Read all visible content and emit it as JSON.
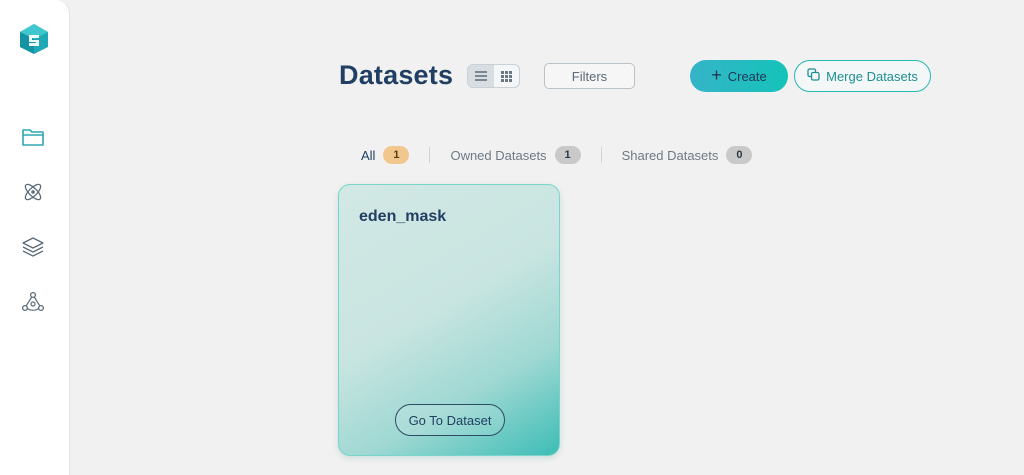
{
  "sidebar": {
    "logo": "app-logo",
    "items": [
      {
        "icon": "folder-icon"
      },
      {
        "icon": "atom-icon"
      },
      {
        "icon": "layers-icon"
      },
      {
        "icon": "network-icon"
      }
    ]
  },
  "header": {
    "title": "Datasets",
    "view_toggle": {
      "options": [
        "list-view-icon",
        "grid-view-icon"
      ],
      "active": "list-view-icon"
    },
    "filters_label": "Filters",
    "create_label": "Create",
    "merge_label": "Merge Datasets"
  },
  "tabs": [
    {
      "label": "All",
      "count": "1",
      "active": true
    },
    {
      "label": "Owned Datasets",
      "count": "1",
      "active": false
    },
    {
      "label": "Shared Datasets",
      "count": "0",
      "active": false
    }
  ],
  "datasets": [
    {
      "name": "eden_mask",
      "action_label": "Go To Dataset"
    }
  ],
  "colors": {
    "accent": "#14c3b8",
    "title": "#213f62",
    "badge_all": "#f2c78d",
    "badge_other": "#c9c9c9"
  }
}
